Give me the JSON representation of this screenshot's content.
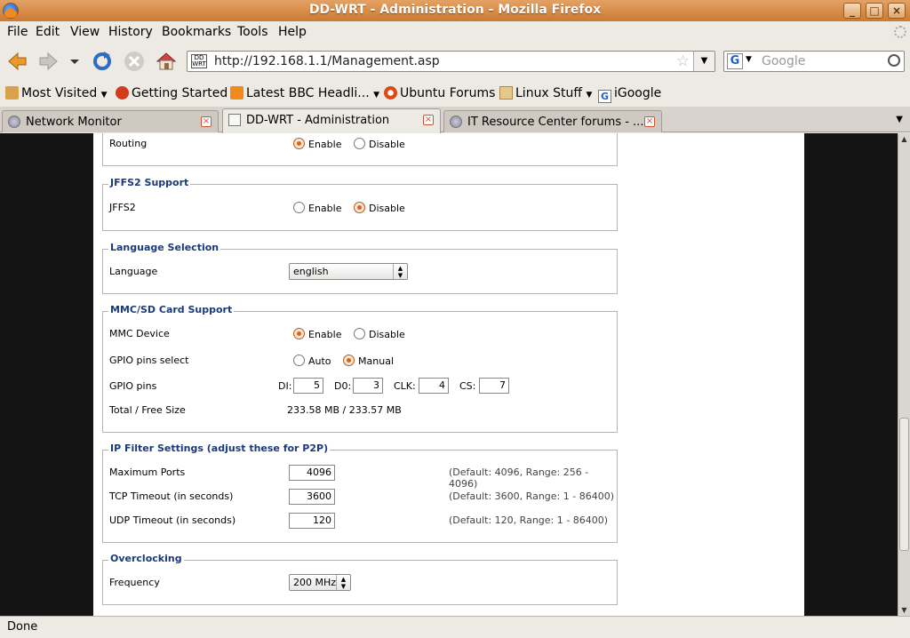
{
  "window": {
    "title": "DD-WRT - Administration - Mozilla Firefox",
    "min": "_",
    "max": "□",
    "close": "×"
  },
  "menu": [
    "File",
    "Edit",
    "View",
    "History",
    "Bookmarks",
    "Tools",
    "Help"
  ],
  "nav": {
    "url": "http://192.168.1.1/Management.asp",
    "favicon_text": "DD WRT",
    "search_placeholder": "Google",
    "search_engine": "G"
  },
  "bookmarks": [
    {
      "label": "Most Visited",
      "icon": "bookmark-star-icon",
      "dropdown": true
    },
    {
      "label": "Getting Started",
      "icon": "firefox-icon",
      "dropdown": false
    },
    {
      "label": "Latest BBC Headli...",
      "icon": "rss-icon",
      "dropdown": true
    },
    {
      "label": "Ubuntu Forums",
      "icon": "ubuntu-icon",
      "dropdown": false
    },
    {
      "label": "Linux Stuff",
      "icon": "folder-icon",
      "dropdown": true
    },
    {
      "label": "iGoogle",
      "icon": "google-icon",
      "dropdown": false
    }
  ],
  "tabs": [
    {
      "label": "Network Monitor",
      "active": false
    },
    {
      "label": "DD-WRT - Administration",
      "active": true
    },
    {
      "label": "IT Resource Center forums - ...",
      "active": false
    }
  ],
  "sections": {
    "routing": {
      "label": "Routing",
      "enable": "Enable",
      "disable": "Disable",
      "selected": "enable"
    },
    "jffs2": {
      "legend": "JFFS2 Support",
      "label": "JFFS2",
      "enable": "Enable",
      "disable": "Disable",
      "selected": "disable"
    },
    "language": {
      "legend": "Language Selection",
      "label": "Language",
      "value": "english"
    },
    "mmc": {
      "legend": "MMC/SD Card Support",
      "device_label": "MMC Device",
      "enable": "Enable",
      "disable": "Disable",
      "gpio_select_label": "GPIO pins select",
      "auto": "Auto",
      "manual": "Manual",
      "gpio_pins_label": "GPIO pins",
      "di_label": "DI:",
      "di": "5",
      "do_label": "D0:",
      "do": "3",
      "clk_label": "CLK:",
      "clk": "4",
      "cs_label": "CS:",
      "cs": "7",
      "size_label": "Total / Free Size",
      "size": "233.58 MB / 233.57 MB"
    },
    "ipfilter": {
      "legend": "IP Filter Settings (adjust these for P2P)",
      "max_ports_label": "Maximum Ports",
      "max_ports": "4096",
      "max_ports_hint": "(Default: 4096, Range: 256 - 4096)",
      "tcp_label": "TCP Timeout (in seconds)",
      "tcp": "3600",
      "tcp_hint": "(Default: 3600, Range: 1 - 86400)",
      "udp_label": "UDP Timeout (in seconds)",
      "udp": "120",
      "udp_hint": "(Default: 120, Range: 1 - 86400)"
    },
    "overclock": {
      "legend": "Overclocking",
      "label": "Frequency",
      "value": "200 MHz"
    }
  },
  "status": "Done"
}
